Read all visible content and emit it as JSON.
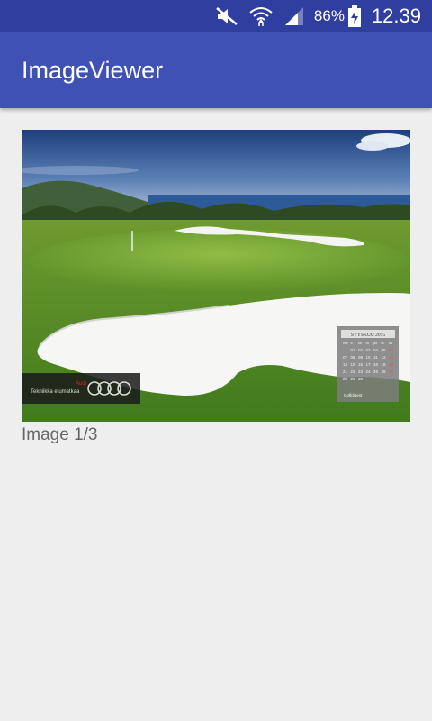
{
  "status_bar": {
    "icons": [
      "mute-icon",
      "wifi-icon",
      "signal-icon",
      "battery-charging-icon"
    ],
    "battery": "86%",
    "time": "12.39"
  },
  "app_bar": {
    "title": "ImageViewer"
  },
  "viewer": {
    "image_description": "golf-course-with-bunker-photo",
    "caption": "Image 1/3",
    "overlay_brand": "Audi",
    "overlay_slogan": "Tekniikka etumatkaa",
    "calendar_title": "SYYSKUU 2015",
    "calendar_days": [
      "ma",
      "ti",
      "ke",
      "to",
      "pe",
      "la",
      "su"
    ],
    "calendar_rows": [
      [
        "",
        "01",
        "02",
        "03",
        "04",
        "05",
        "06"
      ],
      [
        "07",
        "08",
        "09",
        "10",
        "11",
        "12",
        "13"
      ],
      [
        "14",
        "15",
        "16",
        "17",
        "18",
        "19",
        "20"
      ],
      [
        "21",
        "22",
        "23",
        "24",
        "25",
        "26",
        "27"
      ],
      [
        "28",
        "29",
        "30",
        "",
        "",
        "",
        ""
      ]
    ],
    "calendar_footer": "Golfdigest"
  }
}
